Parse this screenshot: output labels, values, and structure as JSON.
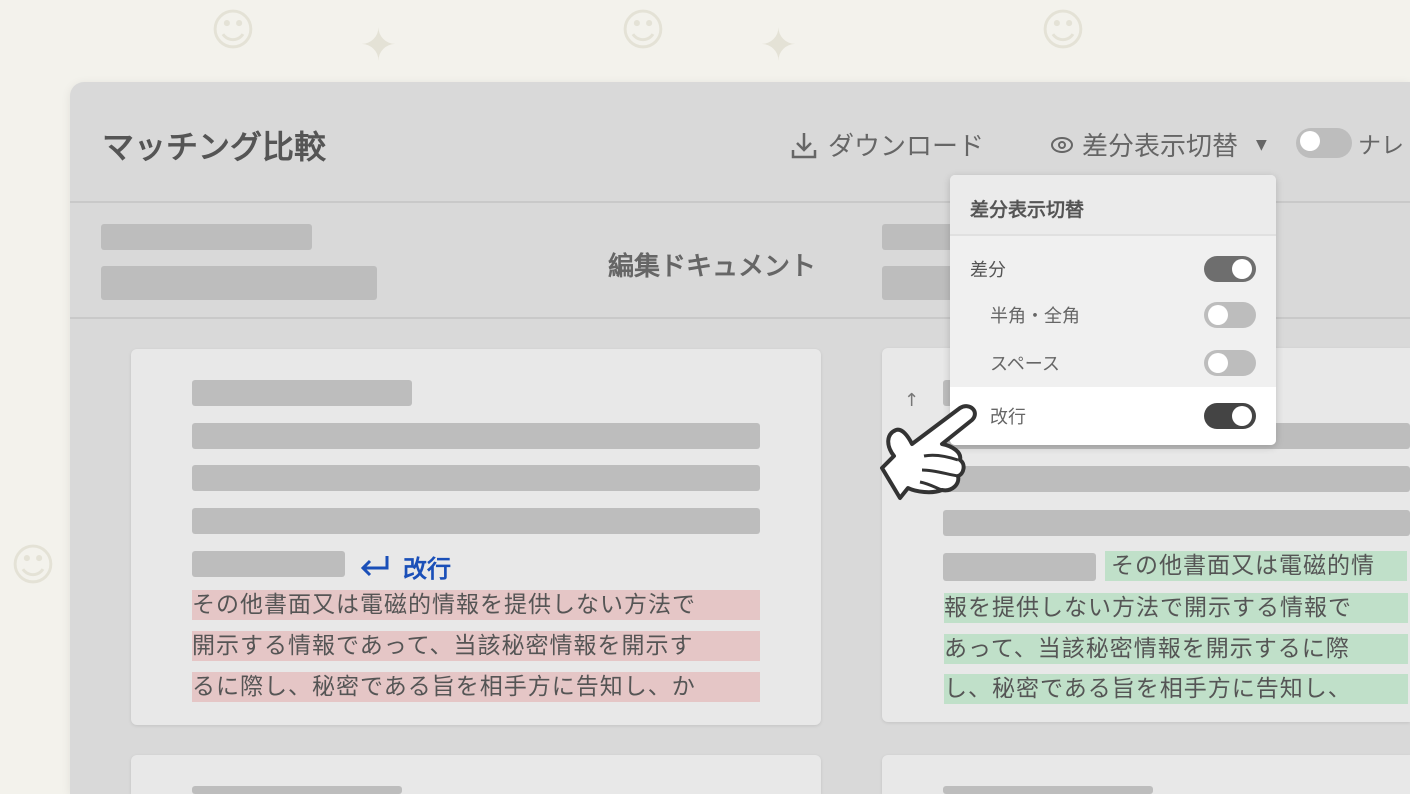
{
  "header": {
    "title": "マッチング比較",
    "download_label": "ダウンロード",
    "diff_toggle_label": "差分表示切替",
    "nav_label": "ナレ"
  },
  "subheader": {
    "title": "編集ドキュメント"
  },
  "dropdown": {
    "title": "差分表示切替",
    "items": [
      {
        "label": "差分",
        "on": true
      },
      {
        "label": "半角・全角",
        "on": false
      },
      {
        "label": "スペース",
        "on": false
      },
      {
        "label": "改行",
        "on": true
      }
    ]
  },
  "left_card": {
    "newline_marker": "改行",
    "lines": [
      "その他書面又は電磁的情報を提供しない方法で",
      "開示する情報であって、当該秘密情報を開示す",
      "るに際し、秘密である旨を相手方に告知し、か"
    ],
    "highlight": "#e5c6c6"
  },
  "right_card": {
    "lines": [
      "その他書面又は電磁的情",
      "報を提供しない方法で開示する情報で",
      "あって、当該秘密情報を開示するに際",
      "し、秘密である旨を相手方に告知し、"
    ],
    "highlight": "#c0e0c9"
  },
  "colors": {
    "accent": "#1a4fb8"
  }
}
